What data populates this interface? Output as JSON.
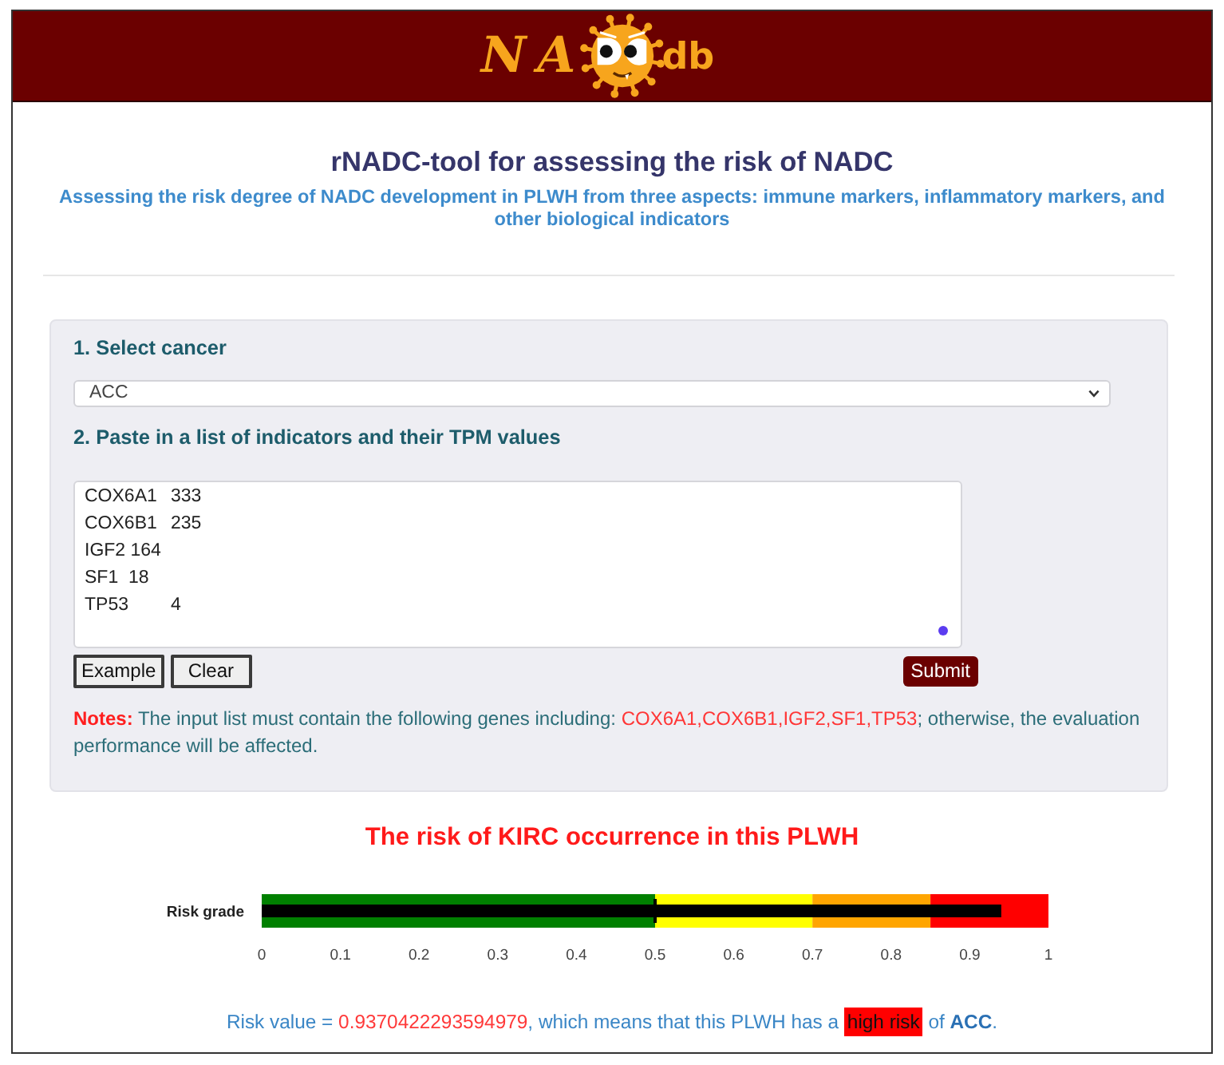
{
  "header": {
    "logo": {
      "prefix": "NA",
      "suffix": "db"
    }
  },
  "intro": {
    "title": "rNADC-tool for assessing the risk of NADC",
    "subtitle": "Assessing the risk degree of NADC development in PLWH from three aspects: immune markers, inflammatory markers, and other biological indicators"
  },
  "form": {
    "steps": [
      {
        "kind": "select",
        "label": "1. Select cancer",
        "value": "ACC"
      },
      {
        "kind": "textarea",
        "label": "2. Paste in a list of indicators and their TPM values",
        "value": "COX6A1\t333\nCOX6B1\t235\nIGF2 164\nSF1  18\nTP53\t4"
      }
    ],
    "buttons": [
      {
        "kind": "plain",
        "label": "Example"
      },
      {
        "kind": "plain",
        "label": "Clear"
      },
      {
        "kind": "primary",
        "label": "Submit"
      }
    ],
    "notes": [
      {
        "kind": "label",
        "text": "Notes:"
      },
      {
        "kind": "plain",
        "text": " The input list must contain the following genes including: "
      },
      {
        "kind": "genes",
        "text": "COX6A1,COX6B1,IGF2,SF1,TP53"
      },
      {
        "kind": "plain",
        "text": "; otherwise, the evaluation performance will be affected."
      }
    ]
  },
  "result": {
    "title": "The risk of KIRC occurrence in this PLWH",
    "chart_data": {
      "type": "bar",
      "orientation": "horizontal",
      "categories": [
        "Risk grade"
      ],
      "values": [
        0.94
      ],
      "xlim": [
        0,
        1
      ],
      "xticks": [
        0,
        0.1,
        0.2,
        0.3,
        0.4,
        0.5,
        0.6,
        0.7,
        0.8,
        0.9,
        1
      ],
      "bands": [
        {
          "axis": "x",
          "from": 0,
          "to": 0.5,
          "color": "#008000"
        },
        {
          "axis": "x",
          "from": 0.5,
          "to": 0.7,
          "color": "#ffff00"
        },
        {
          "axis": "x",
          "from": 0.7,
          "to": 0.85,
          "color": "#ffa500"
        },
        {
          "axis": "x",
          "from": 0.85,
          "to": 1,
          "color": "#ff0000"
        }
      ],
      "ref_lines": [
        {
          "axis": "x",
          "value": 0.5
        }
      ]
    },
    "sentence": [
      {
        "kind": "plain",
        "text": "Risk value = "
      },
      {
        "kind": "value",
        "text": "0.9370422293594979"
      },
      {
        "kind": "plain",
        "text": ", which means that this PLWH has a "
      },
      {
        "kind": "highlight",
        "text": "high risk"
      },
      {
        "kind": "plain",
        "text": " of "
      },
      {
        "kind": "strong",
        "text": "ACC"
      },
      {
        "kind": "plain",
        "text": "."
      }
    ]
  }
}
